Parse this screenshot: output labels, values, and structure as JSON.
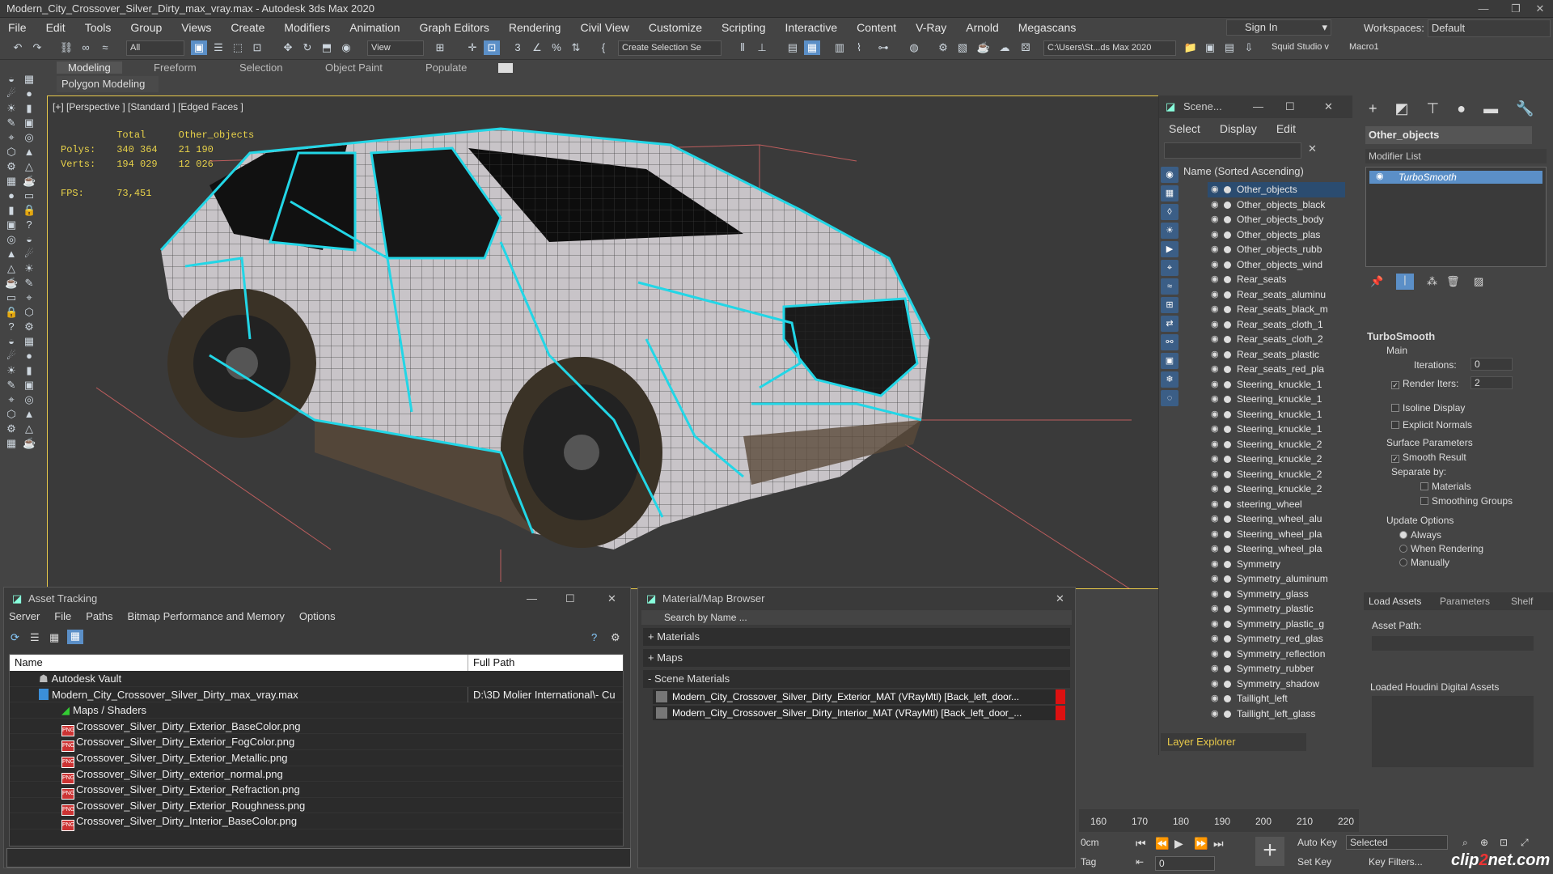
{
  "window": {
    "title": "Modern_City_Crossover_Silver_Dirty_max_vray.max - Autodesk 3ds Max 2020"
  },
  "menu": [
    "File",
    "Edit",
    "Tools",
    "Group",
    "Views",
    "Create",
    "Modifiers",
    "Animation",
    "Graph Editors",
    "Rendering",
    "Civil View",
    "Customize",
    "Scripting",
    "Interactive",
    "Content",
    "V-Ray",
    "Arnold",
    "Megascans"
  ],
  "account": {
    "sign_in": "Sign In",
    "workspaces_label": "Workspaces:",
    "workspace": "Default"
  },
  "toolbar": {
    "filter": "All",
    "view": "View",
    "create_selection": "Create Selection Se",
    "path": "C:\\Users\\St...ds Max 2020",
    "squid": "Squid Studio v",
    "macro": "Macro1"
  },
  "ribbon": {
    "tabs": [
      "Modeling",
      "Freeform",
      "Selection",
      "Object Paint",
      "Populate"
    ],
    "panel": "Polygon Modeling"
  },
  "viewport": {
    "label": "[+] [Perspective ] [Standard ] [Edged Faces ]",
    "stats": {
      "col_total": "Total",
      "col_other": "Other_objects",
      "polys_label": "Polys:",
      "polys_total": "340 364",
      "polys_other": "21 190",
      "verts_label": "Verts:",
      "verts_total": "194 029",
      "verts_other": "12 026",
      "fps_label": "FPS:",
      "fps": "73,451"
    }
  },
  "scene_explorer": {
    "title": "Scene...",
    "menu": [
      "Select",
      "Display",
      "Edit"
    ],
    "column": "Name (Sorted Ascending)",
    "items": [
      "Other_objects",
      "Other_objects_black",
      "Other_objects_body",
      "Other_objects_plas",
      "Other_objects_rubb",
      "Other_objects_wind",
      "Rear_seats",
      "Rear_seats_aluminu",
      "Rear_seats_black_m",
      "Rear_seats_cloth_1",
      "Rear_seats_cloth_2",
      "Rear_seats_plastic",
      "Rear_seats_red_pla",
      "Steering_knuckle_1",
      "Steering_knuckle_1",
      "Steering_knuckle_1",
      "Steering_knuckle_1",
      "Steering_knuckle_2",
      "Steering_knuckle_2",
      "Steering_knuckle_2",
      "Steering_knuckle_2",
      "steering_wheel",
      "Steering_wheel_alu",
      "Steering_wheel_pla",
      "Steering_wheel_pla",
      "Symmetry",
      "Symmetry_aluminum",
      "Symmetry_glass",
      "Symmetry_plastic",
      "Symmetry_plastic_g",
      "Symmetry_red_glas",
      "Symmetry_reflection",
      "Symmetry_rubber",
      "Symmetry_shadow",
      "Taillight_left",
      "Taillight_left_glass"
    ],
    "layer_explorer": "Layer Explorer"
  },
  "command_panel": {
    "object_name": "Other_objects",
    "modifier_list": "Modifier List",
    "stack_item": "TurboSmooth",
    "rollout_title": "TurboSmooth",
    "main": "Main",
    "iterations_label": "Iterations:",
    "iterations": "0",
    "render_iters_label": "Render Iters:",
    "render_iters": "2",
    "isoline": "Isoline Display",
    "explicit_normals": "Explicit Normals",
    "surface_params": "Surface Parameters",
    "smooth_result": "Smooth Result",
    "separate_by": "Separate by:",
    "materials": "Materials",
    "smoothing_groups": "Smoothing Groups",
    "update_options": "Update Options",
    "always": "Always",
    "when_rendering": "When Rendering",
    "manually": "Manually",
    "houdini_tabs": [
      "Load Assets",
      "Parameters",
      "Shelf"
    ],
    "asset_path": "Asset Path:",
    "loaded_houdini": "Loaded Houdini Digital Assets"
  },
  "asset_tracking": {
    "title": "Asset Tracking",
    "menu": [
      "Server",
      "File",
      "Paths",
      "Bitmap Performance and Memory",
      "Options"
    ],
    "col_name": "Name",
    "col_path": "Full Path",
    "rows": [
      {
        "name": "Autodesk Vault",
        "path": ""
      },
      {
        "name": "Modern_City_Crossover_Silver_Dirty_max_vray.max",
        "path": "D:\\3D Molier International\\- Cu"
      },
      {
        "name": "Maps / Shaders",
        "path": ""
      },
      {
        "name": "Crossover_Silver_Dirty_Exterior_BaseColor.png",
        "path": ""
      },
      {
        "name": "Crossover_Silver_Dirty_Exterior_FogColor.png",
        "path": ""
      },
      {
        "name": "Crossover_Silver_Dirty_Exterior_Metallic.png",
        "path": ""
      },
      {
        "name": "Crossover_Silver_Dirty_exterior_normal.png",
        "path": ""
      },
      {
        "name": "Crossover_Silver_Dirty_Exterior_Refraction.png",
        "path": ""
      },
      {
        "name": "Crossover_Silver_Dirty_Exterior_Roughness.png",
        "path": ""
      },
      {
        "name": "Crossover_Silver_Dirty_Interior_BaseColor.png",
        "path": ""
      }
    ]
  },
  "material_browser": {
    "title": "Material/Map Browser",
    "search": "Search by Name ...",
    "sections": [
      "+ Materials",
      "+ Maps",
      "- Scene Materials"
    ],
    "items": [
      "Modern_City_Crossover_Silver_Dirty_Exterior_MAT (VRayMtl) [Back_left_door...",
      "Modern_City_Crossover_Silver_Dirty_Interior_MAT (VRayMtl) [Back_left_door_..."
    ]
  },
  "timeline": {
    "ticks": [
      "160",
      "170",
      "180",
      "190",
      "200",
      "210",
      "220"
    ]
  },
  "animation": {
    "auto_key": "Auto Key",
    "set_key": "Set Key",
    "selected": "Selected",
    "key_filters": "Key Filters...",
    "frame": "0",
    "cm": "0cm",
    "tag": "Tag"
  },
  "watermark": {
    "text": "clip",
    "accent": "2",
    "rest": "net.com"
  },
  "colors": {
    "accent": "#5b8fc7",
    "wire": "#22d6e6",
    "stats": "#e8d24a"
  }
}
